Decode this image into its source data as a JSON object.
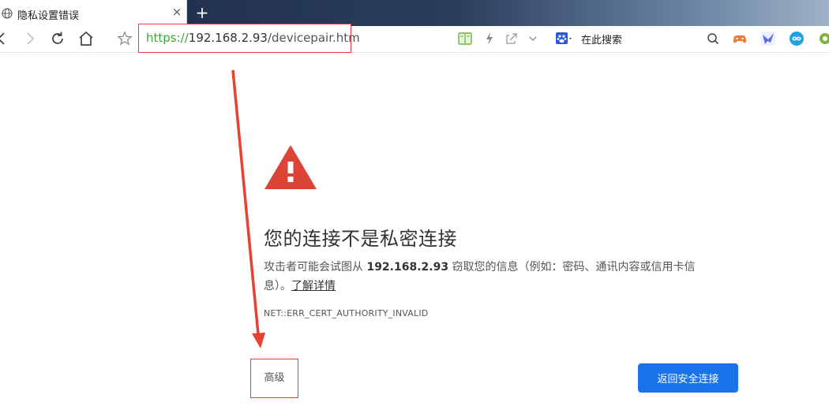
{
  "tab": {
    "title": "隐私设置错误",
    "close": "×",
    "new_tab": "+"
  },
  "toolbar": {
    "address": {
      "scheme": "https://",
      "host": "192.168.2.93",
      "path": "/devicepair.htm"
    },
    "search_placeholder": "在此搜索"
  },
  "page": {
    "heading": "您的连接不是私密连接",
    "desc_prefix": "攻击者可能会试图从 ",
    "desc_host": "192.168.2.93",
    "desc_suffix": " 窃取您的信息（例如：密码、通讯内容或信用卡信息）。",
    "learn_more": "了解详情",
    "error_code": "NET::ERR_CERT_AUTHORITY_INVALID",
    "advanced_label": "高级",
    "back_to_safety_label": "返回安全连接"
  },
  "colors": {
    "warning_red": "#db4437",
    "annotation_red": "#e23c3c",
    "primary_blue": "#1a73e8",
    "https_green": "#3ea33a"
  },
  "icons": [
    "globe-icon",
    "back-icon",
    "forward-icon",
    "reload-icon",
    "home-icon",
    "star-icon",
    "reader-icon",
    "lightning-icon",
    "share-icon",
    "dropdown-chevron-icon",
    "paw-search-engine-icon",
    "search-icon",
    "gamepad-icon",
    "bird-icon",
    "loop-icon",
    "gear-icon",
    "warning-icon"
  ]
}
